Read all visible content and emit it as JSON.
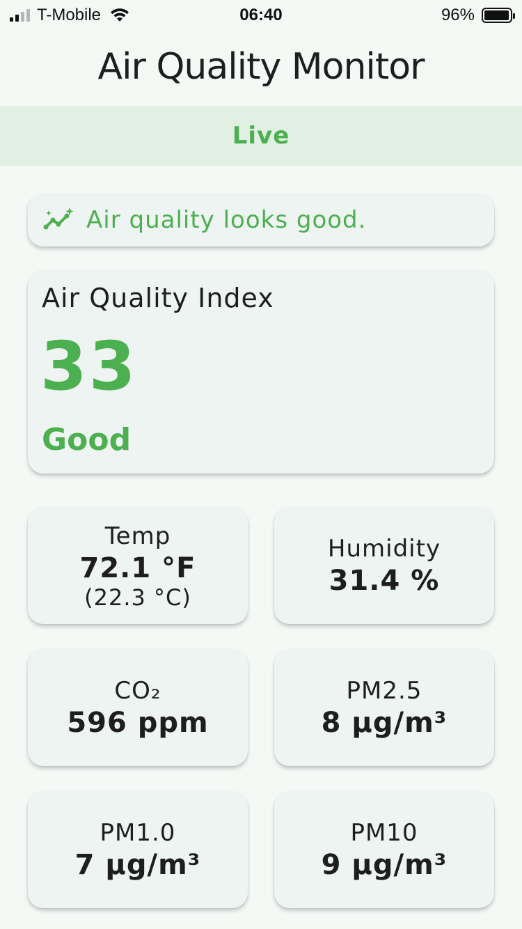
{
  "status_bar": {
    "carrier": "T-Mobile",
    "time": "06:40",
    "battery": "96%"
  },
  "header": {
    "title": "Air Quality Monitor"
  },
  "live": {
    "label": "Live"
  },
  "message": {
    "text": "Air quality looks good.",
    "icon": "sparkle-trend-icon"
  },
  "aqi": {
    "label": "Air Quality Index",
    "value": "33",
    "status": "Good"
  },
  "metrics": {
    "temp": {
      "label": "Temp",
      "value": "72.1 °F",
      "sub": "(22.3 °C)"
    },
    "humidity": {
      "label": "Humidity",
      "value": "31.4 %"
    },
    "co2": {
      "label": "CO₂",
      "value": "596 ppm"
    },
    "pm25": {
      "label": "PM2.5",
      "value": "8 µg/m³"
    },
    "pm10_small": {
      "label": "PM1.0",
      "value": "7 µg/m³"
    },
    "pm10": {
      "label": "PM10",
      "value": "9 µg/m³"
    }
  },
  "colors": {
    "accent": "#4caf50",
    "live_bg": "#e1f0e3",
    "card_bg": "#eef4f1",
    "page_bg": "#f4f9f6"
  }
}
